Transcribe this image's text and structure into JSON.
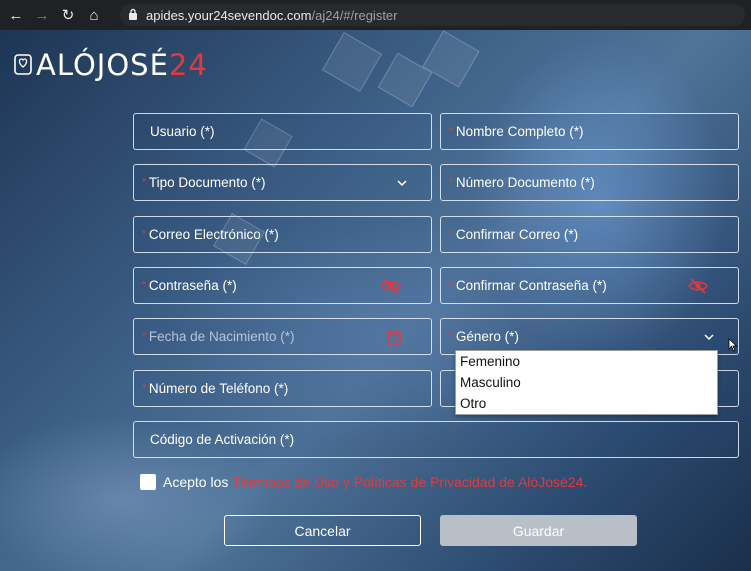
{
  "browser": {
    "url_host": "apides.your24sevendoc.com",
    "url_path": "/aj24/#/register"
  },
  "logo": {
    "text": "ALÓJOSÉ",
    "number": "24"
  },
  "form": {
    "usuario": "Usuario (*)",
    "nombre_completo": "Nombre Completo (*)",
    "tipo_documento": "Tipo Documento (*)",
    "numero_documento": "Número Documento (*)",
    "correo": "Correo Electrónico (*)",
    "confirmar_correo": "Confirmar Correo (*)",
    "contrasena": "Contraseña (*)",
    "confirmar_contrasena": "Confirmar Contraseña (*)",
    "fecha_nacimiento": "Fecha de Nacimiento (*)",
    "genero": "Género (*)",
    "telefono": "Número de Teléfono (*)",
    "codigo_activacion": "Código de Activación (*)",
    "required_mark": "*"
  },
  "genero_options": [
    "Femenino",
    "Masculino",
    "Otro"
  ],
  "consent": {
    "text": "Acepto los",
    "link": "Términos de Uso y Políticas de Privacidad de AlóJosé24."
  },
  "buttons": {
    "cancel": "Cancelar",
    "save": "Guardar"
  },
  "colors": {
    "accent": "#e8373a",
    "save_disabled": "#b9bfc7"
  },
  "icons": [
    "back-arrow-icon",
    "forward-arrow-icon",
    "reload-icon",
    "home-icon",
    "lock-icon",
    "eye-off-icon",
    "calendar-icon",
    "chevron-down-icon",
    "logo-heart-icon"
  ]
}
